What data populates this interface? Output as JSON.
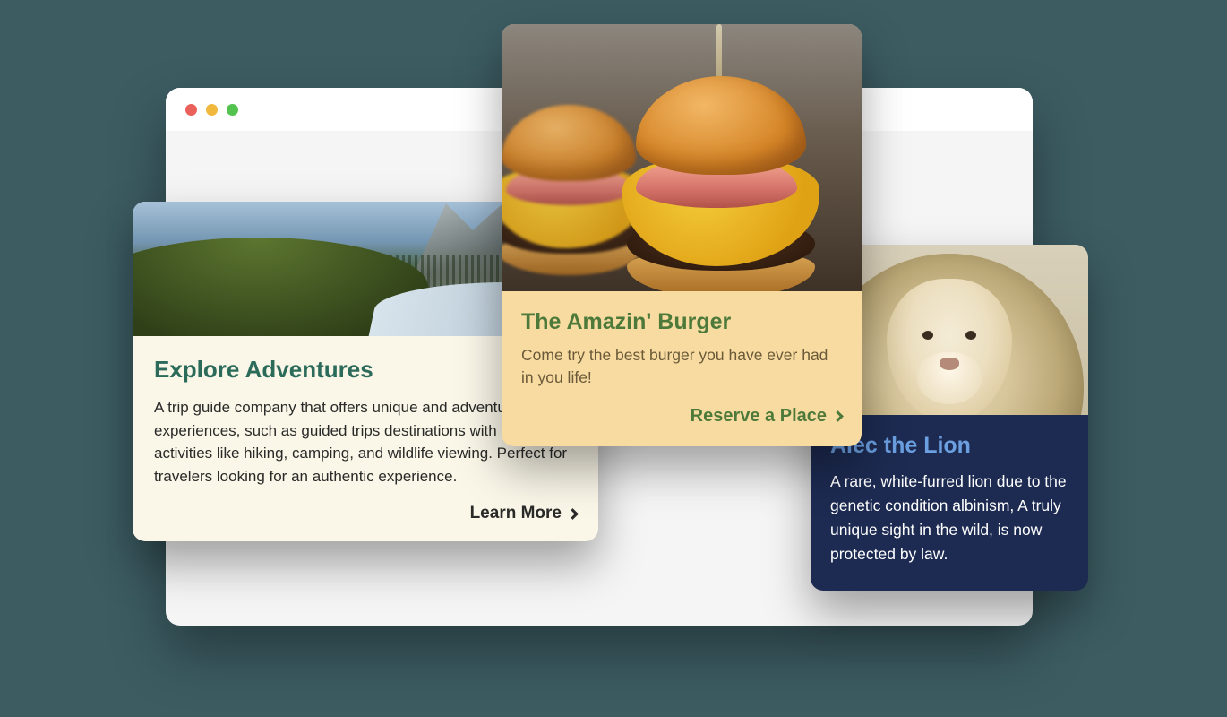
{
  "cards": [
    {
      "title": "Explore Adventures",
      "body": "A trip guide company that offers unique and adventure experiences, such as guided trips destinations with outdoor activities like hiking, camping, and wildlife viewing. Perfect for travelers looking for an authentic experience.",
      "cta": "Learn More"
    },
    {
      "title": "The Amazin' Burger",
      "body": "Come try the best burger you have ever had in you life!",
      "cta": "Reserve a Place"
    },
    {
      "title": "Alec the Lion",
      "body": "A rare, white-furred lion due to the genetic condition albinism, A truly unique sight in the wild, is now protected by law."
    }
  ]
}
